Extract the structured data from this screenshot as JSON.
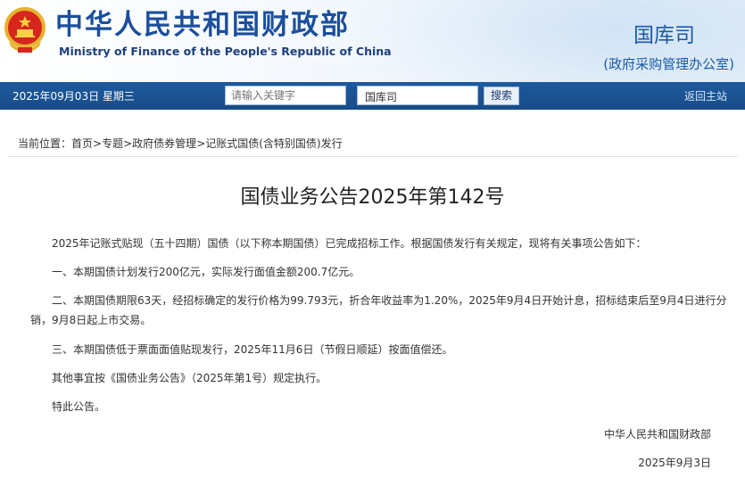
{
  "header": {
    "title_cn": "中华人民共和国财政部",
    "title_en": "Ministry of Finance of the People's Republic of China",
    "dept": "国库司",
    "dept_sub": "(政府采购管理办公室)"
  },
  "nav": {
    "date": "2025年09月03日  星期三",
    "search_placeholder": "请输入关键字",
    "scope_value": "国库司",
    "search_button": "搜索",
    "home_link": "返回主站"
  },
  "breadcrumb": {
    "prefix": "当前位置：",
    "items": [
      "首页",
      "专题",
      "政府债券管理",
      "记账式国债(含特别国债)发行"
    ],
    "separator": ">"
  },
  "article": {
    "title": "国债业务公告2025年第142号",
    "p1": "2025年记账式贴现（五十四期）国债（以下称本期国债）已完成招标工作。根据国债发行有关规定，现将有关事项公告如下：",
    "p2": "一、本期国债计划发行200亿元，实际发行面值金额200.7亿元。",
    "p3_line1": "二、本期国债期限63天，经招标确定的发行价格为99.793元，折合年收益率为1.20%，2025年9月4日开始计息，招标结束后至9月4日进行分",
    "p3_line2": "销，9月8日起上市交易。",
    "p4": "三、本期国债低于票面面值贴现发行，2025年11月6日（节假日顺延）按面值偿还。",
    "p5": "其他事宜按《国债业务公告》（2025年第1号）规定执行。",
    "p6": "特此公告。",
    "signature": "中华人民共和国财政部",
    "date": "2025年9月3日"
  },
  "colors": {
    "header_blue": "#1c4f9c",
    "nav_bg": "#1d5a9e"
  }
}
